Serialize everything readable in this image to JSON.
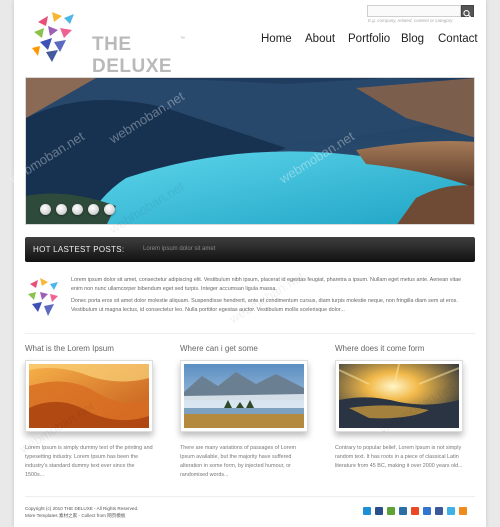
{
  "header": {
    "logo_text": "THE DELUXE",
    "logo_tm": "™",
    "search_placeholder": "",
    "search_hint": "E.g. company, related, content or category"
  },
  "nav": {
    "items": [
      {
        "label": "Home"
      },
      {
        "label": "About"
      },
      {
        "label": "Portfolio"
      },
      {
        "label": "Blog"
      },
      {
        "label": "Contact"
      }
    ]
  },
  "slider": {
    "dot_count": 5,
    "colors": {
      "water": "#35b7d3",
      "mountain": "#1d3b5a",
      "sky": "#2d4f76"
    }
  },
  "latest_posts": {
    "label": "HOT LASTEST POSTS:",
    "value": "Lorem ipsum dolor sit amet"
  },
  "intro": {
    "paragraph_1": "Lorem ipsum dolor sit amet, consectetur adipiscing elit. Vestibulum nibh ipsum, placerat id egestas feugiat, pharetra a ipsum. Nullam eget metus ante. Aenean vitae enim non nunc ullamcorper bibendum eget sed turpis. Integer accumsan ligula massa.",
    "paragraph_2": "Donec porta eros sit amet dolor molestie aliquam. Suspendisse hendrerit, ante et condimentum cursus, diam turpis molestie neque, non fringilla diam sem at eros. Vestibulum ut magna lectus, id consectetur leo. Nulla porttitor egestas auctor. Vestibulum mollis scelerisque dolor..."
  },
  "columns": [
    {
      "title": "What is the Lorem Ipsum",
      "text": "Lorem Ipsum is simply dummy text of the printing and typesetting industry. Lorem Ipsum has been the industry's standard dummy text ever since the 1500s..."
    },
    {
      "title": "Where can i get some",
      "text": "There are many variations of passages of Lorem Ipsum available, but the majority have suffered alteration in some form, by injected humour, or randomised words..."
    },
    {
      "title": "Where does it come form",
      "text": "Contrary to popular belief, Lorem Ipsum is not simply random text. It has roots in a piece of classical Latin literature from 45 BC, making it over 2000 years old..."
    }
  ],
  "footer": {
    "copyright": "Copyright (c) 2010 THE DELUXE - All Rights Reserved.",
    "credit": "More Templates 素材之家 - Collect from 网页模板"
  },
  "social_icons": [
    "skype-icon",
    "myspace-icon",
    "technorati-icon",
    "linkedin-icon",
    "stumbleupon-icon",
    "delicious-icon",
    "facebook-icon",
    "twitter-icon",
    "rss-icon"
  ],
  "social_colors": [
    "#1d8fd6",
    "#2b4f8a",
    "#5da338",
    "#2e6ea7",
    "#eb4924",
    "#3274d0",
    "#3b5998",
    "#3fb1e6",
    "#f08a1d"
  ],
  "watermark": "webmoban.net"
}
